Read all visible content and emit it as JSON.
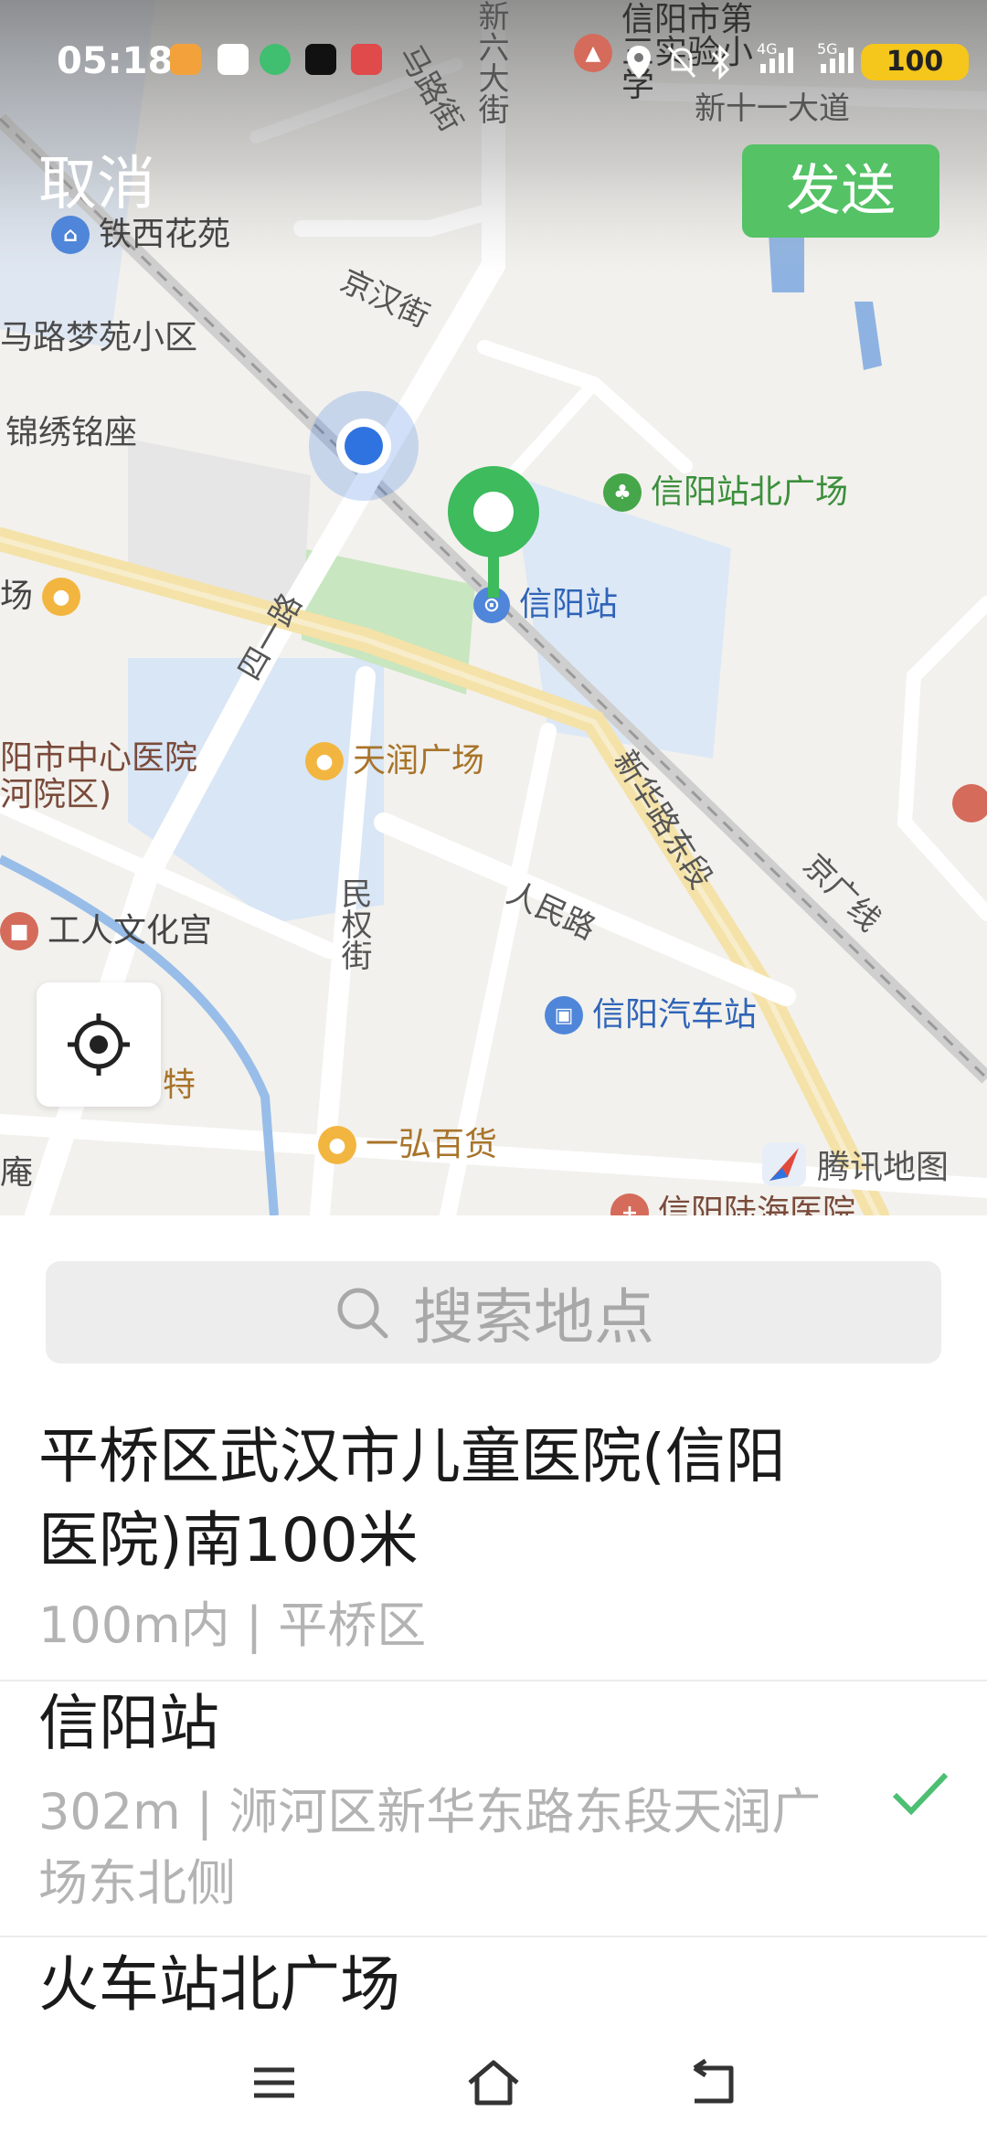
{
  "status_bar": {
    "time": "05:18",
    "battery": "100",
    "net1": "4G",
    "net2": "5G"
  },
  "top_bar": {
    "cancel_label": "取消",
    "send_label": "发送"
  },
  "map": {
    "labels": {
      "school": "信阳市第三实验小学",
      "road_xinliu": "新六大街",
      "road_xinshiyi": "新十一大道",
      "road_ma": "马路街",
      "garden_tiexi": "铁西花苑",
      "meng_yuan": "马路梦苑小区",
      "jinxiu": "锦绣铭座",
      "jinghan": "京汉街",
      "north_square": "信阳站北广场",
      "xinyang_station": "信阳站",
      "chang": "场",
      "siyi_road": "四一路",
      "hospital_line1": "阳市中心医院",
      "hospital_line2": "河院区)",
      "tianrun": "天润广场",
      "xinhua_road": "新华路东段",
      "jingguang": "京广线",
      "minquan": "民权街",
      "renmin": "人民路",
      "workers_palace": "工人文化宫",
      "bus_station": "信阳汽车站",
      "te": "特",
      "yihong": "一弘百货",
      "an": "庵",
      "hospital_bottom": "信阳陆海医院",
      "tencent_map": "腾讯地图"
    }
  },
  "search": {
    "placeholder": "搜索地点"
  },
  "results": [
    {
      "title": "平桥区武汉市儿童医院(信阳医院)南100米",
      "subtitle": "100m内 | 平桥区",
      "selected": false
    },
    {
      "title": "信阳站",
      "subtitle": "302m | 浉河区新华东路东段天润广场东北侧",
      "selected": true
    },
    {
      "title": "火车站北广场",
      "subtitle": "",
      "selected": false
    }
  ],
  "colors": {
    "accent_green": "#54c265",
    "check_green": "#4cbf73",
    "pin_green": "#3dbb5d",
    "location_blue": "#2f73e0"
  }
}
